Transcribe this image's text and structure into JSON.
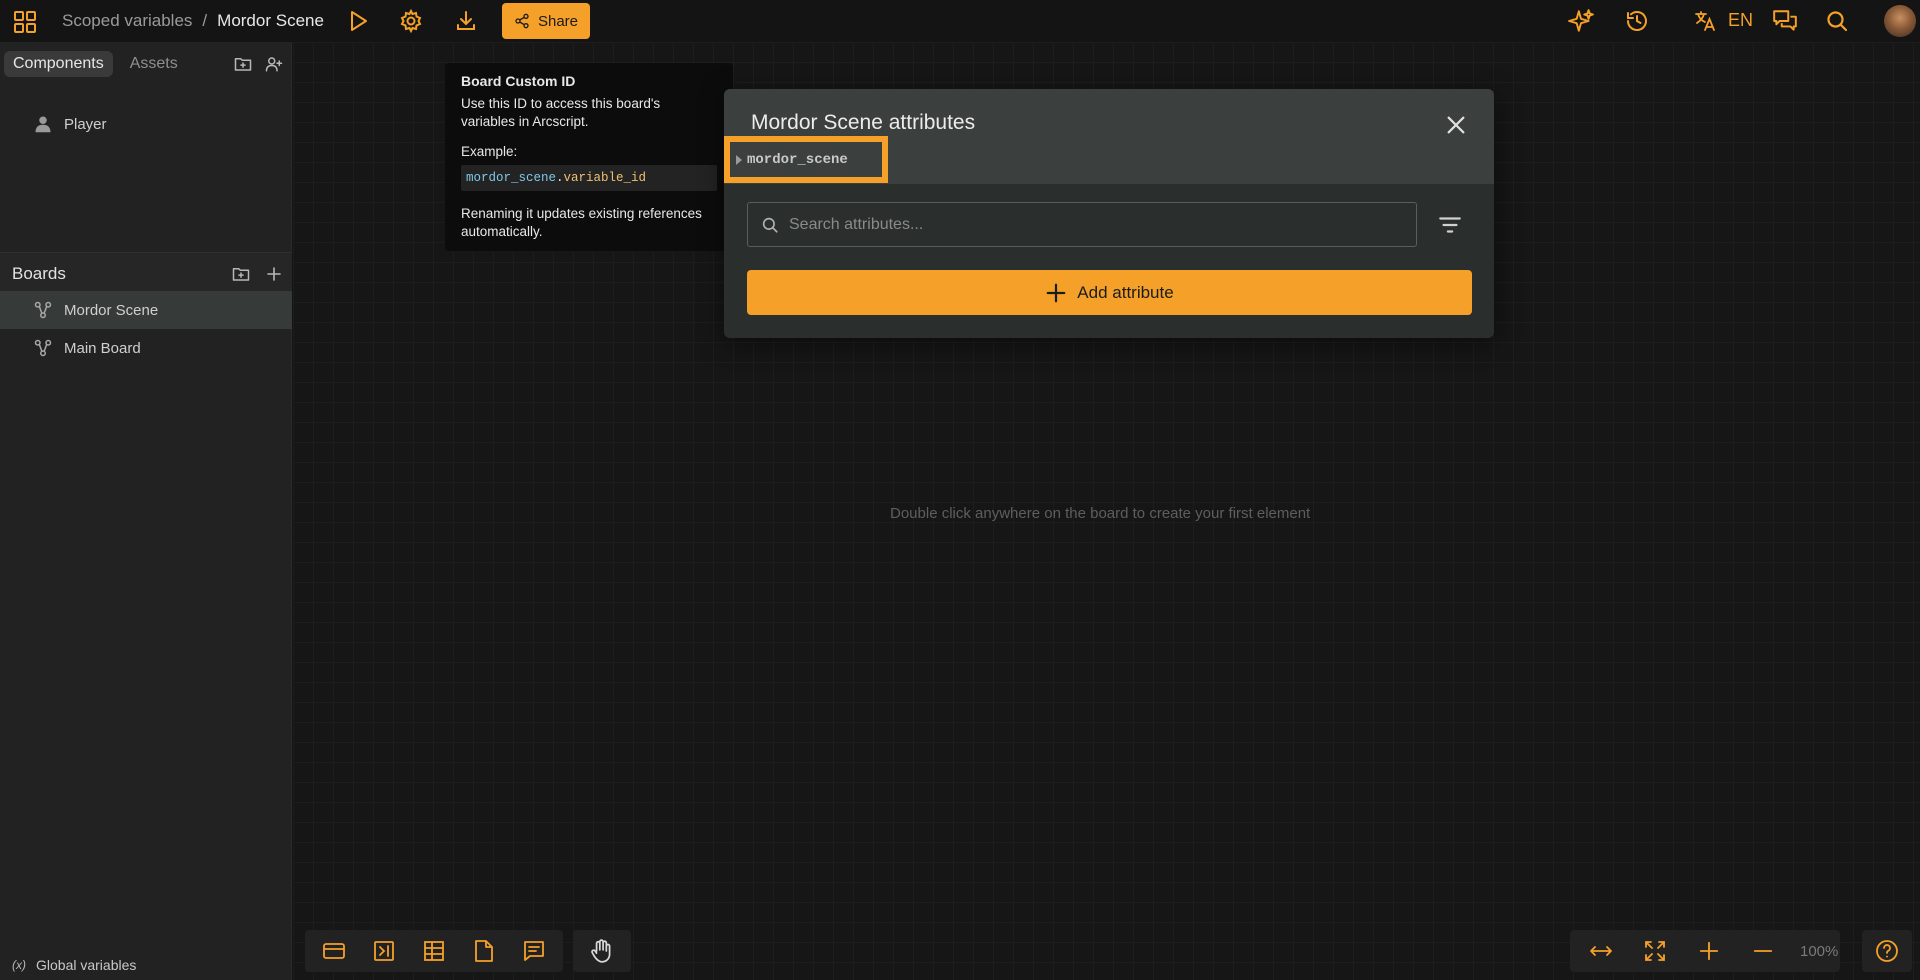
{
  "topbar": {
    "breadcrumb": [
      "Scoped variables",
      "Mordor Scene"
    ],
    "breadcrumb_separator": "/",
    "share_label": "Share",
    "language": "EN",
    "icons": [
      "apps-grid-icon",
      "play-icon",
      "settings-gear-icon",
      "download-icon",
      "share-icon",
      "ai-sparkle-icon",
      "history-icon",
      "translate-icon",
      "comments-icon",
      "search-icon",
      "user-avatar"
    ]
  },
  "sidebar": {
    "tabs": [
      {
        "label": "Components",
        "active": true
      },
      {
        "label": "Assets",
        "active": false
      }
    ],
    "components": [
      {
        "label": "Player",
        "icon": "person-icon"
      }
    ],
    "boards_title": "Boards",
    "boards": [
      {
        "label": "Mordor Scene",
        "icon": "board-graph-icon",
        "selected": true
      },
      {
        "label": "Main Board",
        "icon": "board-graph-icon",
        "selected": false
      }
    ],
    "global_variables_label": "Global variables"
  },
  "canvas": {
    "hint": "Double click anywhere on the board to create your first element",
    "zoom": "100%"
  },
  "tooltip": {
    "title": "Board Custom ID",
    "description": "Use this ID to access this board's variables in Arcscript.",
    "example_label": "Example:",
    "example_code_id": "mordor_scene",
    "example_code_dot": ".",
    "example_code_var": "variable_id",
    "footer": "Renaming it updates existing references automatically."
  },
  "modal": {
    "title": "Mordor Scene attributes",
    "board_id": "mordor_scene",
    "search_placeholder": "Search attributes...",
    "add_label": "Add attribute"
  },
  "colors": {
    "accent": "#f5a028",
    "background": "#141414",
    "sidebar": "#222222",
    "modal": "#2a2e2d"
  }
}
